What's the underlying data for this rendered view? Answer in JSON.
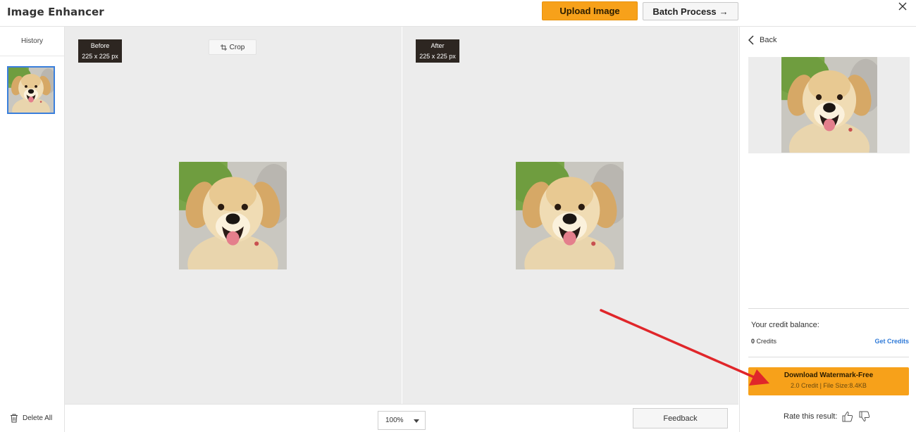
{
  "header": {
    "title": "Image Enhancer",
    "upload_label": "Upload Image",
    "batch_label": "Batch Process",
    "batch_arrow": "→"
  },
  "history": {
    "label": "History",
    "delete_all_label": "Delete All"
  },
  "before_pane": {
    "label": "Before",
    "size": "225 x 225 px",
    "crop_label": "Crop"
  },
  "after_pane": {
    "label": "After",
    "size": "225 x 225 px"
  },
  "bottom_bar": {
    "zoom_value": "100%",
    "feedback_label": "Feedback"
  },
  "right_panel": {
    "back_label": "Back",
    "credit_balance_label": "Your credit balance:",
    "credit_count": "0",
    "credit_unit": "Credits",
    "get_credits_label": "Get Credits",
    "download_title": "Download Watermark-Free",
    "download_sub": "2.0 Credit | File Size:8.4KB",
    "rate_label": "Rate this result:"
  },
  "colors": {
    "accent_orange": "#f7a11a",
    "link_blue": "#2f7ad8",
    "selection_blue": "#3a7fdc",
    "annotation_red": "#e0262a",
    "pane_bg": "#ececec"
  },
  "icons": {
    "close": "close-icon",
    "trash": "trash-icon",
    "crop": "crop-icon",
    "back": "chevron-left-icon",
    "thumbs_up": "thumbs-up-icon",
    "thumbs_down": "thumbs-down-icon",
    "zoom_caret": "caret-down-icon"
  }
}
